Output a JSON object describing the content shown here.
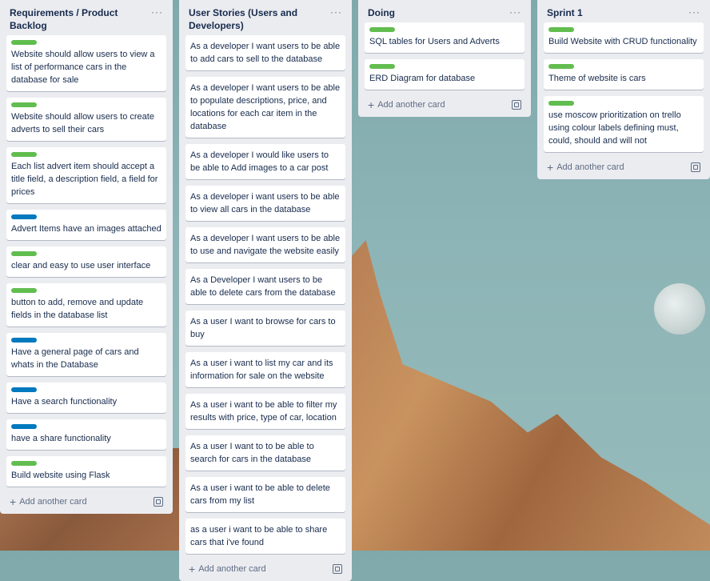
{
  "lists": [
    {
      "title": "Requirements / Product Backlog",
      "menu": "···",
      "add_label": "Add another card",
      "cards": [
        {
          "label": "green",
          "text": "Website should allow users to view a list of performance cars in the database for sale"
        },
        {
          "label": "green",
          "text": "Website should allow users to create adverts to sell their cars"
        },
        {
          "label": "green",
          "text": "Each list advert item should accept a title field, a description field, a field for prices"
        },
        {
          "label": "blue",
          "text": "Advert Items have an images attached"
        },
        {
          "label": "green",
          "text": "clear and easy to use user interface"
        },
        {
          "label": "green",
          "text": "button to add, remove and update fields in the database list"
        },
        {
          "label": "blue",
          "text": "Have a general page of cars and whats in the Database"
        },
        {
          "label": "blue",
          "text": "Have a search functionality"
        },
        {
          "label": "blue",
          "text": "have a share functionality"
        },
        {
          "label": "green",
          "text": "Build website using Flask"
        }
      ]
    },
    {
      "title": "User Stories (Users and Developers)",
      "menu": "···",
      "add_label": "Add another card",
      "cards": [
        {
          "label": "",
          "text": "As a developer I want users to be able to add cars to sell to the database"
        },
        {
          "label": "",
          "text": "As a developer I want users to be able to populate descriptions, price, and locations for each car item in the database"
        },
        {
          "label": "",
          "text": "As a developer I would like users to be able to Add images to a car post"
        },
        {
          "label": "",
          "text": "As a developer i want users to be able to view all cars in the database"
        },
        {
          "label": "",
          "text": "As a developer I want users to be able to use and navigate the website easily"
        },
        {
          "label": "",
          "text": "As a Developer I want users to be able to delete cars from the database"
        },
        {
          "label": "",
          "text": "As a user I want to browse for cars to buy"
        },
        {
          "label": "",
          "text": "As a user i want to list my car and its information for sale on the website"
        },
        {
          "label": "",
          "text": "As a user i want to be able to filter my results with price, type of car, location"
        },
        {
          "label": "",
          "text": "As a user I want to to be able to search for cars in the database"
        },
        {
          "label": "",
          "text": "As a user i want to be able to delete cars from my list"
        },
        {
          "label": "",
          "text": "as a user i want to be able to share cars that i've found"
        }
      ]
    },
    {
      "title": "Doing",
      "menu": "···",
      "add_label": "Add another card",
      "cards": [
        {
          "label": "green",
          "text": "SQL tables for Users and Adverts"
        },
        {
          "label": "green",
          "text": "ERD Diagram for database"
        }
      ]
    },
    {
      "title": "Sprint 1",
      "menu": "···",
      "add_label": "Add another card",
      "cards": [
        {
          "label": "green",
          "text": "Build Website with CRUD functionality"
        },
        {
          "label": "green",
          "text": "Theme of website is cars"
        },
        {
          "label": "green",
          "text": "use moscow prioritization on trello using colour labels defining must, could, should and will not"
        }
      ]
    }
  ],
  "colors": {
    "green_label": "#61bd4f",
    "blue_label": "#0079bf",
    "list_bg": "#ebecf0"
  }
}
